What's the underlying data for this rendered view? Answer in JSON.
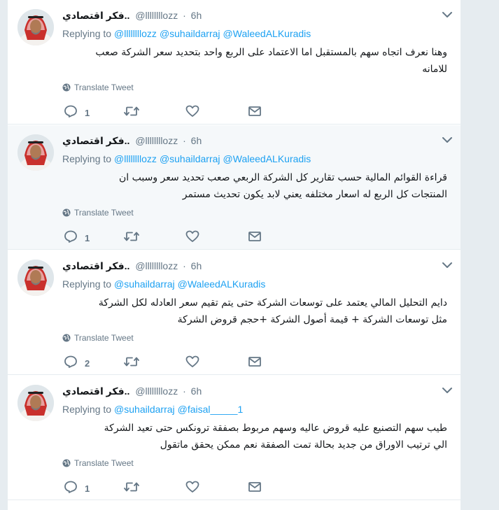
{
  "tweets": [
    {
      "fullname": "فكر اقتصادي..",
      "username": "@llllllllozz",
      "time": "6h",
      "replying_label": "Replying to",
      "mentions": [
        "@llllllllozz",
        "@suhaildarraj",
        "@WaleedALKuradis"
      ],
      "line1": "وهنا نعرف اتجاه سهم بالمستقبل اما الاعتماد على الربع واحد بتحديد سعر الشركة صعب",
      "line2": "للامانه",
      "translate": "Translate Tweet",
      "reply_count": "1",
      "highlight": false
    },
    {
      "fullname": "فكر اقتصادي..",
      "username": "@llllllllozz",
      "time": "6h",
      "replying_label": "Replying to",
      "mentions": [
        "@llllllllozz",
        "@suhaildarraj",
        "@WaleedALKuradis"
      ],
      "line1": "قراءة القوائم المالية حسب تقارير كل الشركة الربعي صعب تحديد سعر وسبب ان",
      "line2": "المنتجات كل الربع له اسعار مختلفه يعني لابد يكون تحديث مستمر",
      "translate": "Translate Tweet",
      "reply_count": "1",
      "highlight": true
    },
    {
      "fullname": "فكر اقتصادي..",
      "username": "@llllllllozz",
      "time": "6h",
      "replying_label": "Replying to",
      "mentions": [
        "@suhaildarraj",
        "@WaleedALKuradis"
      ],
      "line1": "دايم التحليل المالي يعتمد على توسعات الشركة حتى يتم تقيم سعر العادله لكل الشركة",
      "line2": "مثل توسعات الشركة + قيمة أصول الشركة +حجم قروض الشركة",
      "translate": "Translate Tweet",
      "reply_count": "2",
      "highlight": false
    },
    {
      "fullname": "فكر اقتصادي..",
      "username": "@llllllllozz",
      "time": "6h",
      "replying_label": "Replying to",
      "mentions": [
        "@suhaildarraj",
        "@faisal_____1"
      ],
      "line1": "طيب سهم التصنيع عليه قروض عاليه وسهم مربوط بصفقة ترونكس  حتى تعيد الشركة",
      "line2": "الي ترتيب الاوراق من جديد بحالة تمت الصفقة نعم ممكن يحقق ماتقول",
      "translate": "Translate Tweet",
      "reply_count": "1",
      "highlight": false
    }
  ],
  "icons": {
    "caret": "chevron-down-icon",
    "reply": "reply-icon",
    "retweet": "retweet-icon",
    "like": "heart-icon",
    "dm": "envelope-icon",
    "translate": "globe-icon"
  },
  "colors": {
    "link": "#1da1f2",
    "muted": "#657786",
    "hover_bg": "#f5f8fa",
    "page_bg": "#e6ecf0"
  }
}
